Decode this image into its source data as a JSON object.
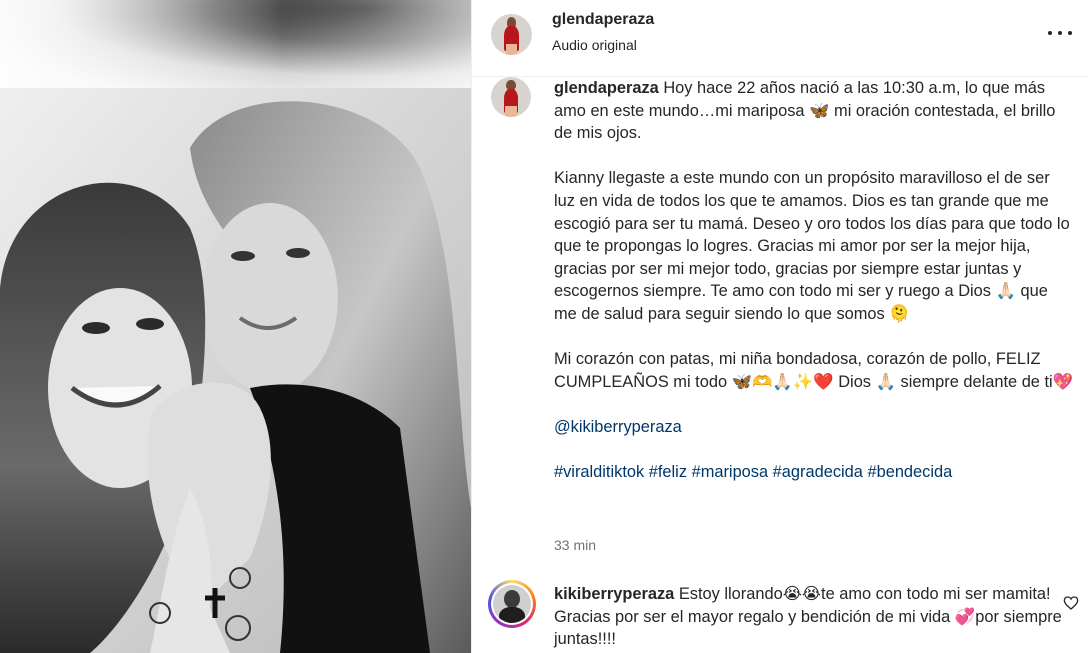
{
  "header": {
    "username": "glendaperaza",
    "audio": "Audio original",
    "more_icon": "more-horizontal-icon"
  },
  "caption": {
    "username": "glendaperaza",
    "para1": "Hoy hace 22 años nació a las 10:30 a.m, lo que más amo en este mundo…mi mariposa 🦋 mi oración contestada, el brillo de mis ojos.",
    "para2": "Kianny llegaste a este mundo con un propósito maravilloso el de ser luz en vida de todos los que te amamos. Dios es tan grande que me escogió para ser tu mamá. Deseo y oro todos los días para que todo lo que te propongas lo logres. Gracias mi amor por ser la mejor hija, gracias por ser mi mejor todo, gracias por siempre estar juntas y escogernos siempre. Te amo con todo mi ser y ruego a Dios 🙏🏻 que me de salud para seguir siendo lo que somos 🫠",
    "para3": "Mi corazón con patas, mi niña bondadosa, corazón de pollo, FELIZ CUMPLEAÑOS mi todo 🦋🫶🙏🏻✨❤️ Dios 🙏🏻 siempre delante de ti💖",
    "mention": "@kikiberryperaza",
    "hashtags": [
      "#viralditiktok",
      "#feliz",
      "#mariposa",
      "#agradecida",
      "#bendecida"
    ],
    "time": "33 min"
  },
  "comment": {
    "username": "kikiberryperaza",
    "text": "Estoy llorando😭😭te amo con todo mi ser mamita! Gracias por ser el mayor regalo y bendición de mi vida 💞por siempre juntas!!!!",
    "like_icon": "heart-outline-icon"
  },
  "colors": {
    "link": "#00376b",
    "text": "#262626",
    "muted": "#737373",
    "border": "#efefef"
  }
}
